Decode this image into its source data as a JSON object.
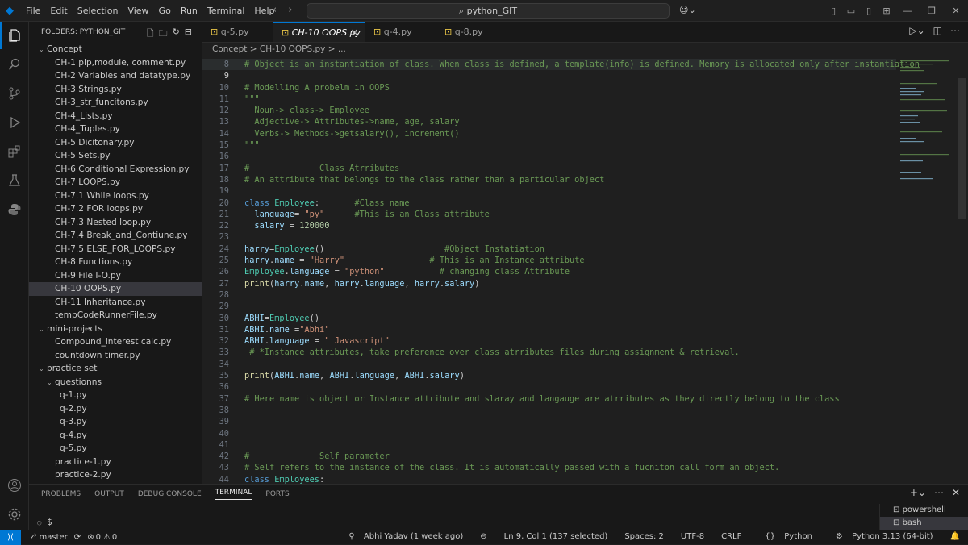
{
  "menu": [
    "File",
    "Edit",
    "Selection",
    "View",
    "Go",
    "Run",
    "Terminal",
    "Help"
  ],
  "search": "python_GIT",
  "explorer": {
    "title": "FOLDERS: PYTHON_GIT",
    "items": [
      {
        "label": "Concept",
        "indent": 1,
        "folder": true
      },
      {
        "label": "CH-1 pip,module, comment.py",
        "indent": 2
      },
      {
        "label": "CH-2 Variables and datatype.py",
        "indent": 2
      },
      {
        "label": "CH-3 Strings.py",
        "indent": 2
      },
      {
        "label": "CH-3_str_funcitons.py",
        "indent": 2
      },
      {
        "label": "CH-4_Lists.py",
        "indent": 2
      },
      {
        "label": "CH-4_Tuples.py",
        "indent": 2
      },
      {
        "label": "CH-5 Dicitonary.py",
        "indent": 2
      },
      {
        "label": "CH-5 Sets.py",
        "indent": 2
      },
      {
        "label": "CH-6 Conditional Expression.py",
        "indent": 2
      },
      {
        "label": "CH-7 LOOPS.py",
        "indent": 2
      },
      {
        "label": "CH-7.1 While loops.py",
        "indent": 2
      },
      {
        "label": "CH-7.2 FOR loops.py",
        "indent": 2
      },
      {
        "label": "CH-7.3 Nested loop.py",
        "indent": 2
      },
      {
        "label": "CH-7.4 Break_and_Contiune.py",
        "indent": 2
      },
      {
        "label": "CH-7.5 ELSE_FOR_LOOPS.py",
        "indent": 2
      },
      {
        "label": "CH-8 Functions.py",
        "indent": 2
      },
      {
        "label": "CH-9 File I-O.py",
        "indent": 2
      },
      {
        "label": "CH-10 OOPS.py",
        "indent": 2,
        "selected": true
      },
      {
        "label": "CH-11 Inheritance.py",
        "indent": 2
      },
      {
        "label": "tempCodeRunnerFile.py",
        "indent": 2
      },
      {
        "label": "mini-projects",
        "indent": 1,
        "folder": true
      },
      {
        "label": "Compound_interest calc.py",
        "indent": 2
      },
      {
        "label": "countdown timer.py",
        "indent": 2
      },
      {
        "label": "practice set",
        "indent": 1,
        "folder": true
      },
      {
        "label": "questionns",
        "indent": 2,
        "folder": true
      },
      {
        "label": "q-1.py",
        "indent": 3
      },
      {
        "label": "q-2.py",
        "indent": 3
      },
      {
        "label": "q-3.py",
        "indent": 3
      },
      {
        "label": "q-4.py",
        "indent": 3
      },
      {
        "label": "q-5.py",
        "indent": 3
      },
      {
        "label": "practice-1.py",
        "indent": 2
      },
      {
        "label": "practice-2.py",
        "indent": 2
      }
    ]
  },
  "tabs": [
    {
      "label": "q-5.py"
    },
    {
      "label": "CH-10 OOPS.py",
      "active": true
    },
    {
      "label": "q-4.py"
    },
    {
      "label": "q-8.py"
    }
  ],
  "breadcrumb": "Concept  >  CH-10 OOPS.py  >  ...",
  "code": [
    {
      "n": "8",
      "h": "<span class='c'># Object is an instantiation of class. When class is defined, a template(info) is defined. Memory is allocated only after instantiation</span>",
      "hl": true
    },
    {
      "n": "9",
      "h": "",
      "cur": true
    },
    {
      "n": "10",
      "h": "<span class='c'># Modelling A probelm in OOPS</span>"
    },
    {
      "n": "11",
      "h": "<span class='c'>\"\"\"</span>"
    },
    {
      "n": "12",
      "h": "<span class='c'>  Noun-> class-> Employee</span>"
    },
    {
      "n": "13",
      "h": "<span class='c'>  Adjective-> Attributes->name, age, salary</span>"
    },
    {
      "n": "14",
      "h": "<span class='c'>  Verbs-> Methods->getsalary(), increment()</span>"
    },
    {
      "n": "15",
      "h": "<span class='c'>\"\"\"</span>"
    },
    {
      "n": "16",
      "h": ""
    },
    {
      "n": "17",
      "h": "<span class='c'>#              Class Atrributes</span>"
    },
    {
      "n": "18",
      "h": "<span class='c'># An attribute that belongs to the class rather than a particular object</span>"
    },
    {
      "n": "19",
      "h": ""
    },
    {
      "n": "20",
      "h": "<span class='k'>class</span> <span class='cl'>Employee</span>:       <span class='c'>#Class name</span>"
    },
    {
      "n": "21",
      "h": "  <span class='v'>language</span>= <span class='s'>\"py\"</span>      <span class='c'>#This is an Class attribute</span>"
    },
    {
      "n": "22",
      "h": "  <span class='v'>salary</span> = <span class='n'>120000</span>"
    },
    {
      "n": "23",
      "h": ""
    },
    {
      "n": "24",
      "h": "<span class='v'>harry</span>=<span class='cl'>Employee</span>()                        <span class='c'>#Object Instatiation</span>"
    },
    {
      "n": "25",
      "h": "<span class='v'>harry</span>.<span class='v'>name</span> = <span class='s'>\"Harry\"</span>                 <span class='c'># This is an Instance attribute</span>"
    },
    {
      "n": "26",
      "h": "<span class='cl'>Employee</span>.<span class='v'>language</span> = <span class='s'>\"python\"</span>           <span class='c'># changing class Attribute</span>"
    },
    {
      "n": "27",
      "h": "<span class='f'>print</span>(<span class='v'>harry</span>.<span class='v'>name</span>, <span class='v'>harry</span>.<span class='v'>language</span>, <span class='v'>harry</span>.<span class='v'>salary</span>)"
    },
    {
      "n": "28",
      "h": ""
    },
    {
      "n": "29",
      "h": ""
    },
    {
      "n": "30",
      "h": "<span class='v'>ABHI</span>=<span class='cl'>Employee</span>()"
    },
    {
      "n": "31",
      "h": "<span class='v'>ABHI</span>.<span class='v'>name</span> =<span class='s'>\"Abhi\"</span>"
    },
    {
      "n": "32",
      "h": "<span class='v'>ABHI</span>.<span class='v'>language</span> = <span class='s'>\" Javascript\"</span>"
    },
    {
      "n": "33",
      "h": " <span class='c'># *Instance attributes, take preference over class atrributes files during assignment &amp; retrieval.</span>"
    },
    {
      "n": "34",
      "h": ""
    },
    {
      "n": "35",
      "h": "<span class='f'>print</span>(<span class='v'>ABHI</span>.<span class='v'>name</span>, <span class='v'>ABHI</span>.<span class='v'>language</span>, <span class='v'>ABHI</span>.<span class='v'>salary</span>)"
    },
    {
      "n": "36",
      "h": ""
    },
    {
      "n": "37",
      "h": "<span class='c'># Here name is object or Instance attribute and slaray and langauge are atrributes as they directly belong to the class</span>"
    },
    {
      "n": "38",
      "h": ""
    },
    {
      "n": "39",
      "h": ""
    },
    {
      "n": "40",
      "h": ""
    },
    {
      "n": "41",
      "h": ""
    },
    {
      "n": "42",
      "h": "<span class='c'>#              Self parameter</span>"
    },
    {
      "n": "43",
      "h": "<span class='c'># Self refers to the instance of the class. It is automatically passed with a fucniton call form an object.</span>"
    },
    {
      "n": "44",
      "h": "<span class='k'>class</span> <span class='cl'>Employees</span>:"
    }
  ],
  "panel": {
    "tabs": [
      "PROBLEMS",
      "OUTPUT",
      "DEBUG CONSOLE",
      "TERMINAL",
      "PORTS"
    ],
    "active": "TERMINAL",
    "prompt": "$",
    "terminals": [
      "powershell",
      "bash"
    ]
  },
  "status": {
    "branch": "master",
    "errors": "0",
    "warnings": "0",
    "blame": "Abhi Yadav (1 week ago)",
    "position": "Ln 9, Col 1 (137 selected)",
    "spaces": "Spaces: 2",
    "encoding": "UTF-8",
    "eol": "CRLF",
    "language": "Python",
    "interpreter": "Python 3.13 (64-bit)"
  }
}
